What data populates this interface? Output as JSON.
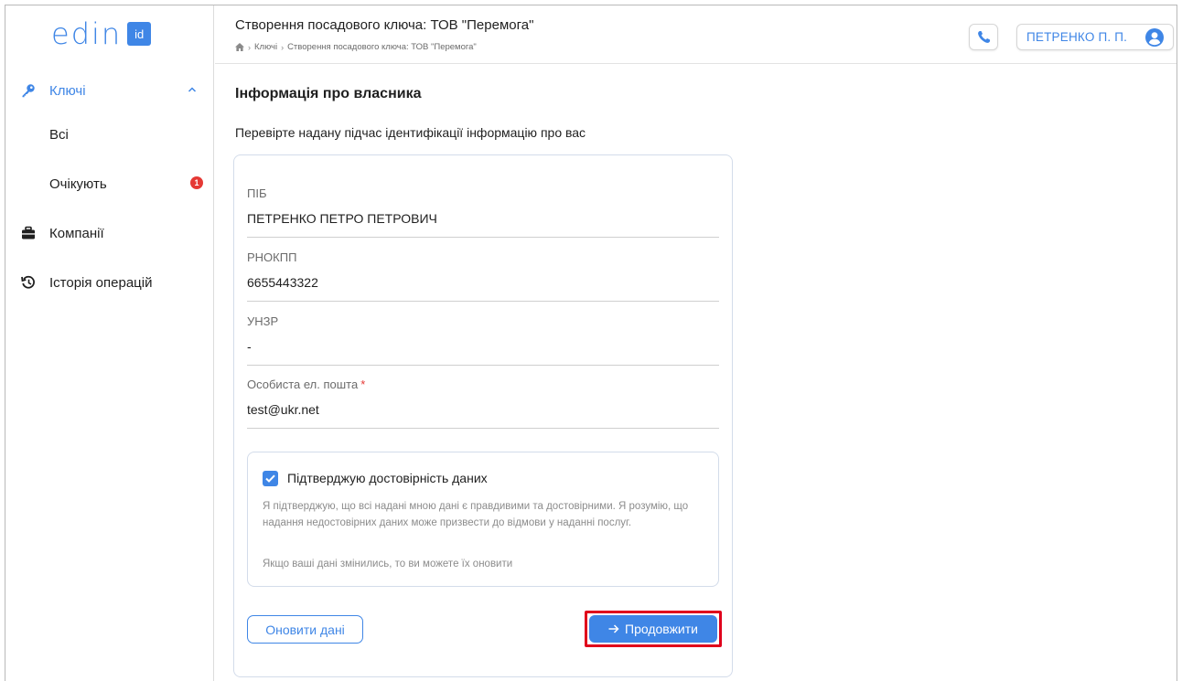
{
  "app": {
    "logo_text": "edin",
    "logo_badge": "id"
  },
  "sidebar": {
    "items": [
      {
        "label": "Ключі",
        "icon": "key-icon",
        "active": true,
        "expanded": true
      },
      {
        "label": "Всі"
      },
      {
        "label": "Очікують",
        "badge": "1"
      },
      {
        "label": "Компанії",
        "icon": "briefcase-icon"
      },
      {
        "label": "Історія операцій",
        "icon": "history-icon"
      }
    ]
  },
  "header": {
    "title": "Створення посадового ключа: ТОВ \"Перемога\"",
    "breadcrumb": [
      "Ключі",
      "Створення посадового ключа: ТОВ \"Перемога\""
    ],
    "user_name": "ПЕТРЕНКО П. П."
  },
  "main": {
    "section_title": "Інформація про власника",
    "section_subtitle": "Перевірте надану підчас ідентифікації інформацію про вас",
    "fields": [
      {
        "label": "ПІБ",
        "value": "ПЕТРЕНКО ПЕТРО ПЕТРОВИЧ"
      },
      {
        "label": "РНОКПП",
        "value": "6655443322"
      },
      {
        "label": "УНЗР",
        "value": "-"
      },
      {
        "label": "Особиста ел. пошта",
        "value": "test@ukr.net",
        "required_mark": "*"
      }
    ],
    "confirm": {
      "checked": true,
      "title": "Підтверджую достовірність даних",
      "text": "Я підтверджую, що всі надані мною дані є правдивими та достовірними. Я розумію, що надання недостовірних даних може призвести до відмови у наданні послуг.",
      "note": "Якщо ваші дані змінились, то ви можете їх оновити"
    },
    "update_button": "Оновити дані",
    "continue_button": "Продовжити"
  },
  "colors": {
    "accent": "#3f86e6",
    "badge": "#e53935",
    "highlight": "#e0001b"
  }
}
